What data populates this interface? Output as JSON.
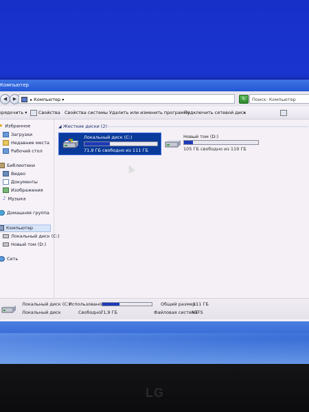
{
  "window": {
    "title": "Компьютер"
  },
  "address": {
    "path": "Компьютер",
    "search_placeholder": "Поиск: Компьютер"
  },
  "toolbar": {
    "organize": "орядочить ▾",
    "properties": "Свойства",
    "system_properties": "Свойства системы",
    "uninstall": "Удалить или изменить программу",
    "map_drive": "Подключить сетевой диск",
    "more": "»"
  },
  "nav": {
    "favorites": "Избранное",
    "downloads": "Загрузки",
    "recent": "Недавние места",
    "desktop": "Рабочий стол",
    "libraries": "Библиотеки",
    "video": "Видео",
    "documents": "Документы",
    "images": "Изображения",
    "music": "Музыка",
    "homegroup": "Домашняя группа",
    "computer": "Компьютер",
    "drive_c": "Локальный диск (C:)",
    "drive_d": "Новый том (D:)",
    "network": "Сеть"
  },
  "content": {
    "group_header": "Жесткие диски (2)",
    "drives": [
      {
        "name": "Локальный диск (C:)",
        "free": "71,9 ГБ свободно из 111 ГБ",
        "used_fraction": 0.35
      },
      {
        "name": "Новый том (D:)",
        "free": "105 ГБ свободно из 119 ГБ",
        "used_fraction": 0.12
      }
    ]
  },
  "details": {
    "drive_label": "Локальный диск (C:)",
    "used_label": "Использовано:",
    "used_fraction": 0.35,
    "type": "Локальный диск",
    "free_label": "Свободно:",
    "free_value": "71,9 ГБ",
    "total_label": "Общий размер:",
    "total_value": "111 ГБ",
    "fs_label": "Файловая система:",
    "fs_value": "NTFS"
  },
  "monitor": {
    "brand": "LG"
  }
}
